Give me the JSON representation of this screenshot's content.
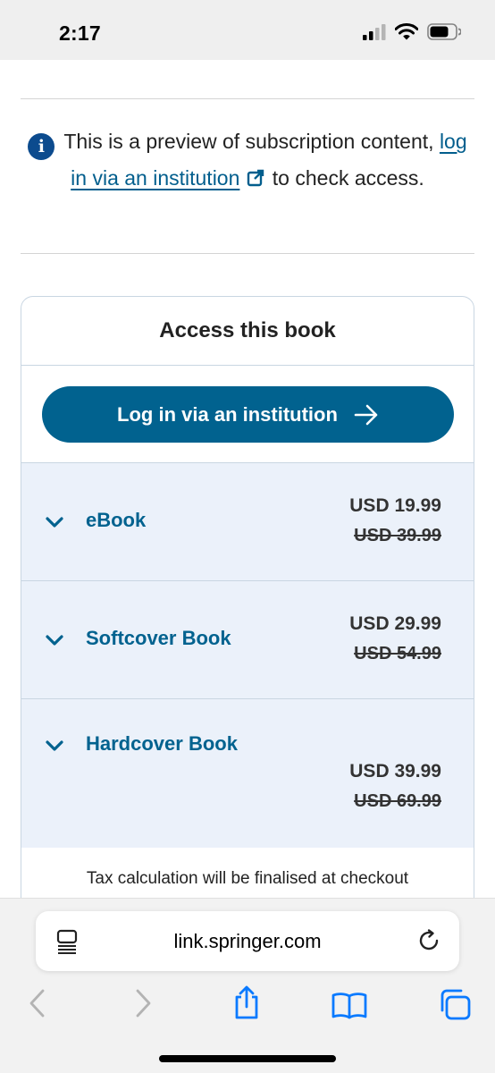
{
  "status_bar": {
    "time": "2:17"
  },
  "preview": {
    "text_before": "This is a preview of subscription content, ",
    "link_text": "log in via an institution",
    "text_after": " to check access."
  },
  "access": {
    "title": "Access this book",
    "login_button": "Log in via an institution",
    "options": [
      {
        "name": "eBook",
        "price": "USD 19.99",
        "old_price": "USD 39.99"
      },
      {
        "name": "Softcover Book",
        "price": "USD 29.99",
        "old_price": "USD 54.99"
      },
      {
        "name": "Hardcover Book",
        "price": "USD 39.99",
        "old_price": "USD 69.99"
      }
    ],
    "tax_note": "Tax calculation will be finalised at checkout"
  },
  "browser": {
    "url": "link.springer.com"
  },
  "colors": {
    "brand_blue": "#01628f",
    "info_blue": "#0c4b8e",
    "option_bg": "#ebf1fa"
  },
  "icons": [
    "info-icon",
    "external-link-icon",
    "arrow-right-icon",
    "chevron-down-icon",
    "reader-icon",
    "reload-icon",
    "back-icon",
    "forward-icon",
    "share-icon",
    "bookmarks-icon",
    "tabs-icon"
  ]
}
